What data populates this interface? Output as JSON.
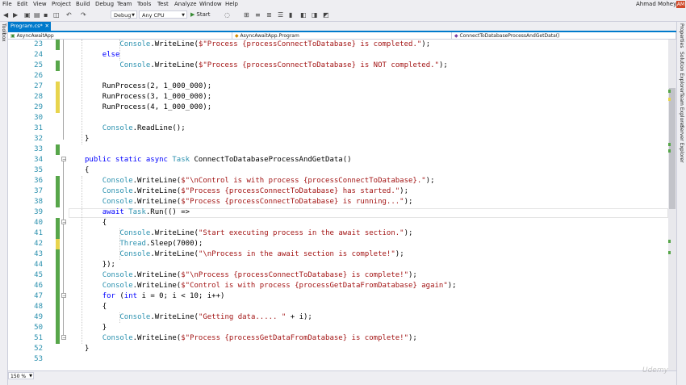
{
  "menu": [
    "File",
    "Edit",
    "View",
    "Project",
    "Build",
    "Debug",
    "Team",
    "Tools",
    "Test",
    "Analyze",
    "Window",
    "Help"
  ],
  "user": {
    "name": "Ahmad Mohey",
    "initials": "AM"
  },
  "toolbar": {
    "config": "Debug",
    "platform": "Any CPU",
    "start_label": "Start"
  },
  "left_rail": {
    "toolbox": "Toolbox"
  },
  "right_rail": [
    "Properties",
    "Solution Explorer",
    "Team Explorer",
    "Server Explorer"
  ],
  "tab": {
    "title": "Program.cs*"
  },
  "navbar": {
    "project": "AsyncAwaitApp",
    "class": "AsyncAwaitApp.Program",
    "member": "ConnectToDatabaseProcessAndGetData()"
  },
  "status": {
    "zoom": "150 %"
  },
  "watermark": "Udemy",
  "colors": {
    "accent": "#007acc",
    "changed_saved": "#57a64a",
    "changed_unsaved": "#e8d44d",
    "keyword": "#0000ff",
    "type": "#2b91af",
    "string": "#a31515"
  },
  "code": [
    {
      "n": "23",
      "indent": 2,
      "change": "green",
      "tokens": [
        [
          "type",
          "Console"
        ],
        [
          "p",
          ".WriteLine("
        ],
        [
          "str",
          "$\"Process {processConnectToDatabase} is completed.\""
        ],
        [
          "p",
          ");"
        ]
      ]
    },
    {
      "n": "24",
      "indent": 1,
      "change": "",
      "tokens": [
        [
          "kw",
          "else"
        ]
      ]
    },
    {
      "n": "25",
      "indent": 2,
      "change": "green",
      "tokens": [
        [
          "type",
          "Console"
        ],
        [
          "p",
          ".WriteLine("
        ],
        [
          "str",
          "$\"Process {processConnectToDatabase} is NOT completed.\""
        ],
        [
          "p",
          ");"
        ]
      ]
    },
    {
      "n": "26",
      "indent": 0,
      "change": "",
      "tokens": []
    },
    {
      "n": "27",
      "indent": 1,
      "change": "yellow",
      "tokens": [
        [
          "p",
          "RunProcess(2, 1_000_000);"
        ]
      ]
    },
    {
      "n": "28",
      "indent": 1,
      "change": "yellow",
      "tokens": [
        [
          "p",
          "RunProcess(3, 1_000_000);"
        ]
      ]
    },
    {
      "n": "29",
      "indent": 1,
      "change": "yellow",
      "tokens": [
        [
          "p",
          "RunProcess(4, 1_000_000);"
        ]
      ]
    },
    {
      "n": "30",
      "indent": 0,
      "change": "",
      "tokens": []
    },
    {
      "n": "31",
      "indent": 1,
      "change": "",
      "tokens": [
        [
          "type",
          "Console"
        ],
        [
          "p",
          ".ReadLine();"
        ]
      ]
    },
    {
      "n": "32",
      "indent": 0,
      "change": "",
      "tokens": [
        [
          "p",
          "}"
        ]
      ]
    },
    {
      "n": "33",
      "indent": 0,
      "change": "green",
      "tokens": []
    },
    {
      "n": "34",
      "indent": 0,
      "change": "",
      "tokens": [
        [
          "kw",
          "public static async "
        ],
        [
          "type",
          "Task"
        ],
        [
          "p",
          " ConnectToDatabaseProcessAndGetData()"
        ]
      ]
    },
    {
      "n": "35",
      "indent": 0,
      "change": "",
      "tokens": [
        [
          "p",
          "{"
        ]
      ]
    },
    {
      "n": "36",
      "indent": 1,
      "change": "green",
      "tokens": [
        [
          "type",
          "Console"
        ],
        [
          "p",
          ".WriteLine("
        ],
        [
          "str",
          "$\"\\nControl is with process {processConnectToDatabase}.\""
        ],
        [
          "p",
          ");"
        ]
      ]
    },
    {
      "n": "37",
      "indent": 1,
      "change": "green",
      "tokens": [
        [
          "type",
          "Console"
        ],
        [
          "p",
          ".WriteLine("
        ],
        [
          "str",
          "$\"Process {processConnectToDatabase} has started.\""
        ],
        [
          "p",
          ");"
        ]
      ]
    },
    {
      "n": "38",
      "indent": 1,
      "change": "green",
      "tokens": [
        [
          "type",
          "Console"
        ],
        [
          "p",
          ".WriteLine("
        ],
        [
          "str",
          "$\"Process {processConnectToDatabase} is running...\""
        ],
        [
          "p",
          ");"
        ]
      ]
    },
    {
      "n": "39",
      "indent": 1,
      "change": "",
      "tokens": [
        [
          "kw",
          "await "
        ],
        [
          "type",
          "Task"
        ],
        [
          "p",
          ".Run(() =>"
        ]
      ]
    },
    {
      "n": "40",
      "indent": 1,
      "change": "green",
      "tokens": [
        [
          "p",
          "{"
        ]
      ]
    },
    {
      "n": "41",
      "indent": 2,
      "change": "green",
      "tokens": [
        [
          "type",
          "Console"
        ],
        [
          "p",
          ".WriteLine("
        ],
        [
          "str",
          "\"Start executing process in the await section.\""
        ],
        [
          "p",
          ");"
        ]
      ]
    },
    {
      "n": "42",
      "indent": 2,
      "change": "yellow",
      "tokens": [
        [
          "type",
          "Thread"
        ],
        [
          "p",
          ".Sleep(7000);"
        ]
      ]
    },
    {
      "n": "43",
      "indent": 2,
      "change": "green",
      "tokens": [
        [
          "type",
          "Console"
        ],
        [
          "p",
          ".WriteLine("
        ],
        [
          "str",
          "\"\\nProcess in the await section is complete!\""
        ],
        [
          "p",
          ");"
        ]
      ]
    },
    {
      "n": "44",
      "indent": 1,
      "change": "green",
      "tokens": [
        [
          "p",
          "});"
        ]
      ]
    },
    {
      "n": "45",
      "indent": 1,
      "change": "green",
      "tokens": [
        [
          "type",
          "Console"
        ],
        [
          "p",
          ".WriteLine("
        ],
        [
          "str",
          "$\"\\nProcess {processConnectToDatabase} is complete!\""
        ],
        [
          "p",
          ");"
        ]
      ]
    },
    {
      "n": "46",
      "indent": 1,
      "change": "green",
      "tokens": [
        [
          "type",
          "Console"
        ],
        [
          "p",
          ".WriteLine("
        ],
        [
          "str",
          "$\"Control is with process {processGetDataFromDatabase} again\""
        ],
        [
          "p",
          ");"
        ]
      ]
    },
    {
      "n": "47",
      "indent": 1,
      "change": "green",
      "tokens": [
        [
          "kw",
          "for"
        ],
        [
          "p",
          " ("
        ],
        [
          "kw",
          "int"
        ],
        [
          "p",
          " i = 0; i < 10; i++)"
        ]
      ]
    },
    {
      "n": "48",
      "indent": 1,
      "change": "green",
      "tokens": [
        [
          "p",
          "{"
        ]
      ]
    },
    {
      "n": "49",
      "indent": 2,
      "change": "green",
      "tokens": [
        [
          "type",
          "Console"
        ],
        [
          "p",
          ".WriteLine("
        ],
        [
          "str",
          "\"Getting data..... \""
        ],
        [
          "p",
          " + i);"
        ]
      ]
    },
    {
      "n": "50",
      "indent": 1,
      "change": "green",
      "tokens": [
        [
          "p",
          "}"
        ]
      ]
    },
    {
      "n": "51",
      "indent": 1,
      "change": "green",
      "tokens": [
        [
          "type",
          "Console"
        ],
        [
          "p",
          ".WriteLine("
        ],
        [
          "str",
          "$\"Process {processGetDataFromDatabase} is complete!\""
        ],
        [
          "p",
          ");"
        ]
      ]
    },
    {
      "n": "52",
      "indent": 0,
      "change": "",
      "tokens": [
        [
          "p",
          "}"
        ]
      ]
    },
    {
      "n": "53",
      "indent": 0,
      "change": "",
      "tokens": []
    }
  ]
}
